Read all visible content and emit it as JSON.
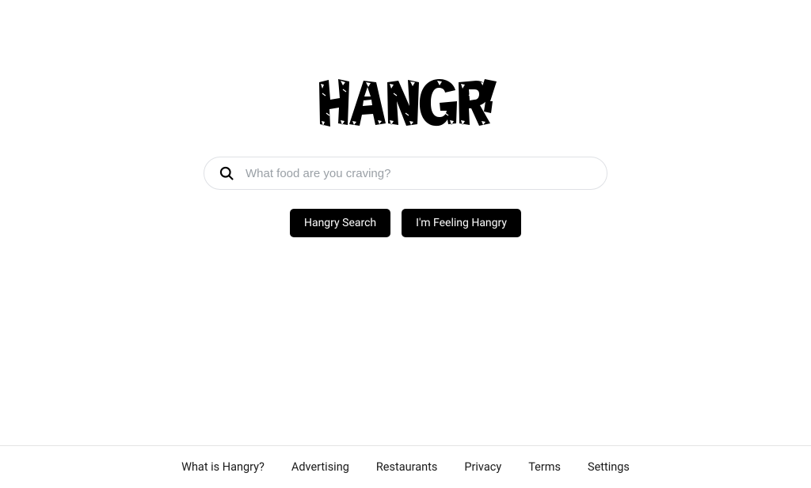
{
  "logo": {
    "text": "HANGRY"
  },
  "search": {
    "placeholder": "What food are you craving?"
  },
  "buttons": {
    "search": "Hangry Search",
    "lucky": "I'm Feeling Hangry"
  },
  "footer": {
    "links": [
      "What is Hangry?",
      "Advertising",
      "Restaurants",
      "Privacy",
      "Terms",
      "Settings"
    ]
  }
}
